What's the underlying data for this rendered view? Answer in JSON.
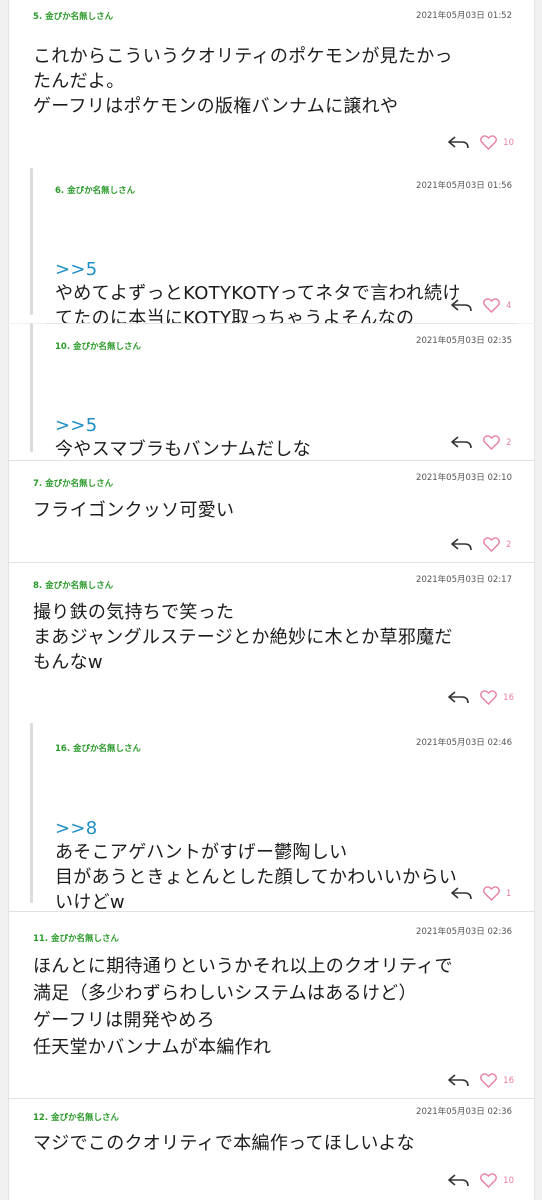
{
  "posts": [
    {
      "id": "p5",
      "name": "5. 金ぴか名無しさん",
      "date": "2021年05月03日 01:52",
      "anchor": "",
      "body": "これからこういうクオリティのポケモンが見たかっ\nたんだよ。\nゲーフリはポケモンの版権バンナムに譲れや",
      "likes": "10"
    },
    {
      "id": "p6",
      "name": "6. 金ぴか名無しさん",
      "date": "2021年05月03日 01:56",
      "anchor": ">>5",
      "body": "やめてよずっとKOTYKOTYってネタで言われ続け\nてたのに本当にKOTY取っちゃうよそんなの",
      "likes": "4"
    },
    {
      "id": "p10",
      "name": "10. 金ぴか名無しさん",
      "date": "2021年05月03日 02:35",
      "anchor": ">>5",
      "body": "今やスマブラもバンナムだしな",
      "likes": "2"
    },
    {
      "id": "p7",
      "name": "7. 金ぴか名無しさん",
      "date": "2021年05月03日 02:10",
      "anchor": "",
      "body": "フライゴンクッソ可愛い",
      "likes": "2"
    },
    {
      "id": "p8",
      "name": "8. 金ぴか名無しさん",
      "date": "2021年05月03日 02:17",
      "anchor": "",
      "body": "撮り鉄の気持ちで笑った\nまあジャングルステージとか絶妙に木とか草邪魔だ\nもんなw",
      "likes": "16"
    },
    {
      "id": "p16",
      "name": "16. 金ぴか名無しさん",
      "date": "2021年05月03日 02:46",
      "anchor": ">>8",
      "body": "あそこアゲハントがすげー鬱陶しい\n目があうときょとんとした顔してかわいいからい\nいけどw",
      "likes": "1"
    },
    {
      "id": "p11",
      "name": "11. 金ぴか名無しさん",
      "date": "2021年05月03日 02:36",
      "anchor": "",
      "body": "ほんとに期待通りというかそれ以上のクオリティで\n満足（多少わずらわしいシステムはあるけど）\nゲーフリは開発やめろ\n任天堂かバンナムが本編作れ",
      "likes": "16"
    },
    {
      "id": "p12",
      "name": "12. 金ぴか名無しさん",
      "date": "2021年05月03日 02:36",
      "anchor": "",
      "body": "マジでこのクオリティで本編作ってほしいよな",
      "likes": "10"
    }
  ]
}
